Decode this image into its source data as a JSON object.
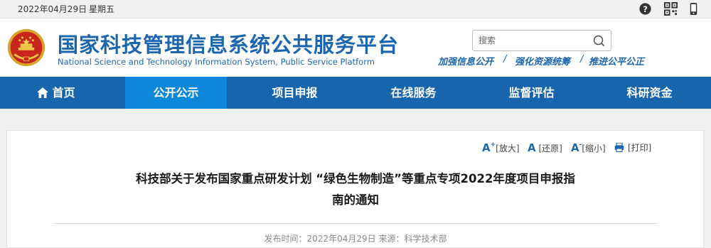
{
  "topbar": {
    "date": "2022年04月29日",
    "weekday": "星期五",
    "icons": [
      "help-icon",
      "qr-code-icon",
      "mobile-icon"
    ]
  },
  "header": {
    "title": "国家科技管理信息系统公共服务平台",
    "subtitle": "National Science and Technology Information System, Public Service Platform",
    "search_placeholder": "搜索",
    "slogan": [
      "加强信息公开",
      "强化资源统筹",
      "推进公平公正"
    ],
    "slogan_sep": "/"
  },
  "nav": {
    "items": [
      {
        "label": "首页"
      },
      {
        "label": "公开公示"
      },
      {
        "label": "项目申报"
      },
      {
        "label": "在线服务"
      },
      {
        "label": "监督评估"
      },
      {
        "label": "科研资金"
      }
    ],
    "active_index": 1
  },
  "tools": {
    "enlarge_glyph": "A",
    "enlarge_label": "[放大]",
    "restore_glyph": "A",
    "restore_label": "[还原]",
    "shrink_glyph": "A",
    "shrink_label": "[缩小]",
    "print_label": "[打印]"
  },
  "article": {
    "title_line1": "科技部关于发布国家重点研发计划 “绿色生物制造”等重点专项2022年度项目申报指",
    "title_line2": "南的通知",
    "meta": "发布时间：2022年04月29日 来源：科学技术部"
  },
  "colors": {
    "brand_blue": "#1c66b0",
    "nav_bg": "#1665ad",
    "nav_active": "#0d87d9"
  }
}
